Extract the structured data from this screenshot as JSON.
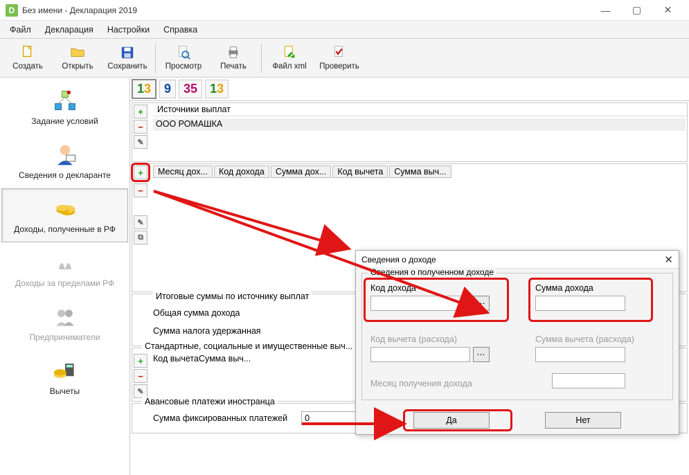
{
  "window": {
    "title": "Без имени - Декларация 2019"
  },
  "menu": {
    "file": "Файл",
    "decl": "Декларация",
    "settings": "Настройки",
    "help": "Справка"
  },
  "toolbar": {
    "create": "Создать",
    "open": "Открыть",
    "save": "Сохранить",
    "preview": "Просмотр",
    "print": "Печать",
    "xml": "Файл xml",
    "check": "Проверить"
  },
  "nav": {
    "conditions": "Задание условий",
    "declarant": "Сведения о декларанте",
    "income_rf": "Доходы, полученные в РФ",
    "income_foreign": "Доходы за пределами РФ",
    "entrepreneurs": "Предприниматели",
    "deductions": "Вычеты"
  },
  "tabs": {
    "t13a": "13",
    "t9": "9",
    "t35": "35",
    "t13b": "13"
  },
  "sources": {
    "header": "Источники выплат",
    "row1": "ООО РОМАШКА"
  },
  "cols": {
    "month": "Месяц дох...",
    "code": "Код дохода",
    "sum": "Сумма дох...",
    "dcode": "Код вычета",
    "dsum": "Сумма выч..."
  },
  "summary": {
    "legend": "Итоговые суммы по источнику выплат",
    "total": "Общая сумма дохода",
    "tax": "Сумма налога удержанная"
  },
  "std": {
    "legend": "Стандартные, социальные и имущественные выч...",
    "c1": "Код вычета",
    "c2": "Сумма выч..."
  },
  "avans": {
    "legend": "Авансовые платежи иностранца",
    "label": "Сумма фиксированных платежей",
    "value": "0"
  },
  "dialog": {
    "title": "Сведения о доходе",
    "group_legend": "Сведения о полученном доходе",
    "income_code": "Код дохода",
    "income_sum": "Сумма дохода",
    "ded_code": "Код вычета (расхода)",
    "ded_sum": "Сумма вычета (расхода)",
    "month": "Месяц получения дохода",
    "ok": "Да",
    "cancel": "Нет"
  }
}
